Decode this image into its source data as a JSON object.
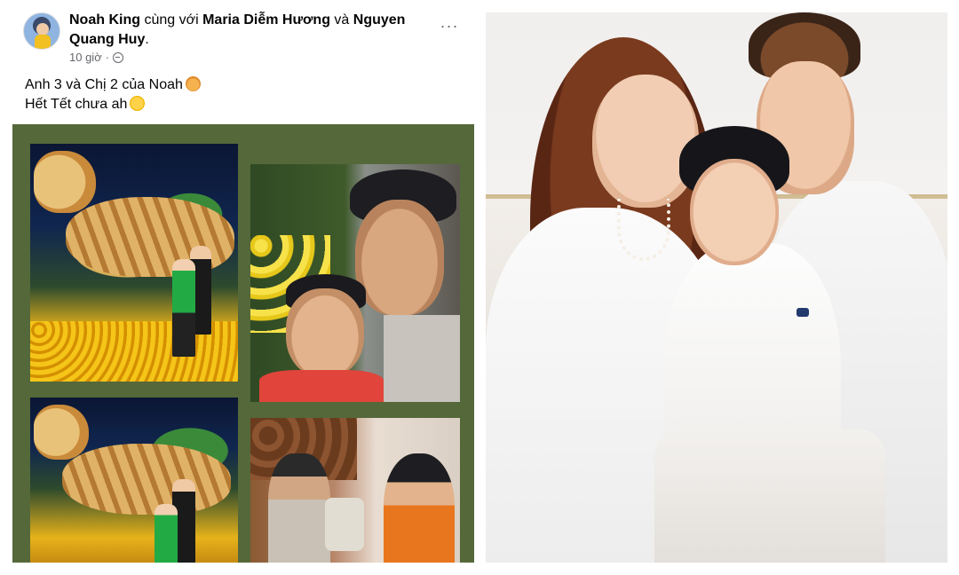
{
  "post": {
    "author": "Noah King",
    "with_text": "cùng với",
    "tagged_1": "Maria Diễm Hương",
    "and_text": "và",
    "tagged_2": "Nguyen Quang Huy",
    "period": ".",
    "time": "10 giờ",
    "dot": "·",
    "more_label": "···",
    "line_1": "Anh 3 và Chị 2 của Noah",
    "line_2": "Hết Tết chưa ah",
    "audience_icon": "globe-icon",
    "emoji_1": "cat-face-emoji",
    "emoji_2": "thinking-face-emoji"
  },
  "colors": {
    "grid_background": "#55683a",
    "muted_text": "#65676b",
    "text": "#050505"
  }
}
